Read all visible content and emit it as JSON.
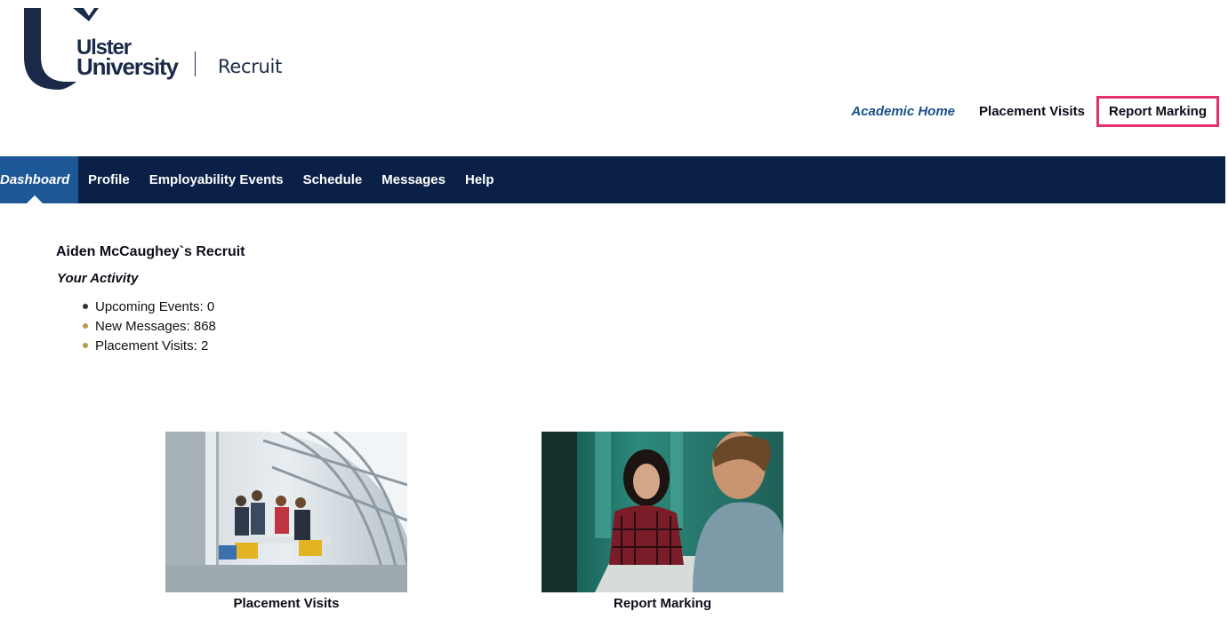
{
  "header": {
    "logo_line1": "Ulster",
    "logo_line2": "University",
    "logo_product": "Recruit",
    "brand_color": "#1c2a4a"
  },
  "top_links": {
    "academic_home": "Academic Home",
    "placement_visits": "Placement Visits",
    "report_marking": "Report Marking",
    "highlight_color": "#e4306f"
  },
  "nav": {
    "items": [
      {
        "label": "Dashboard",
        "active": true
      },
      {
        "label": "Profile",
        "active": false
      },
      {
        "label": "Employability Events",
        "active": false
      },
      {
        "label": "Schedule",
        "active": false
      },
      {
        "label": "Messages",
        "active": false
      },
      {
        "label": "Help",
        "active": false
      }
    ],
    "bar_color": "#0b2046",
    "active_color": "#1d5796"
  },
  "main": {
    "title": "Aiden McCaughey`s Recruit",
    "subtitle": "Your Activity",
    "activity": [
      "Upcoming Events: 0",
      "New Messages: 868",
      "Placement Visits: 2"
    ]
  },
  "tiles": [
    {
      "label": "Placement Visits",
      "image": "office-meeting-photo"
    },
    {
      "label": "Report Marking",
      "image": "student-interview-photo"
    }
  ]
}
